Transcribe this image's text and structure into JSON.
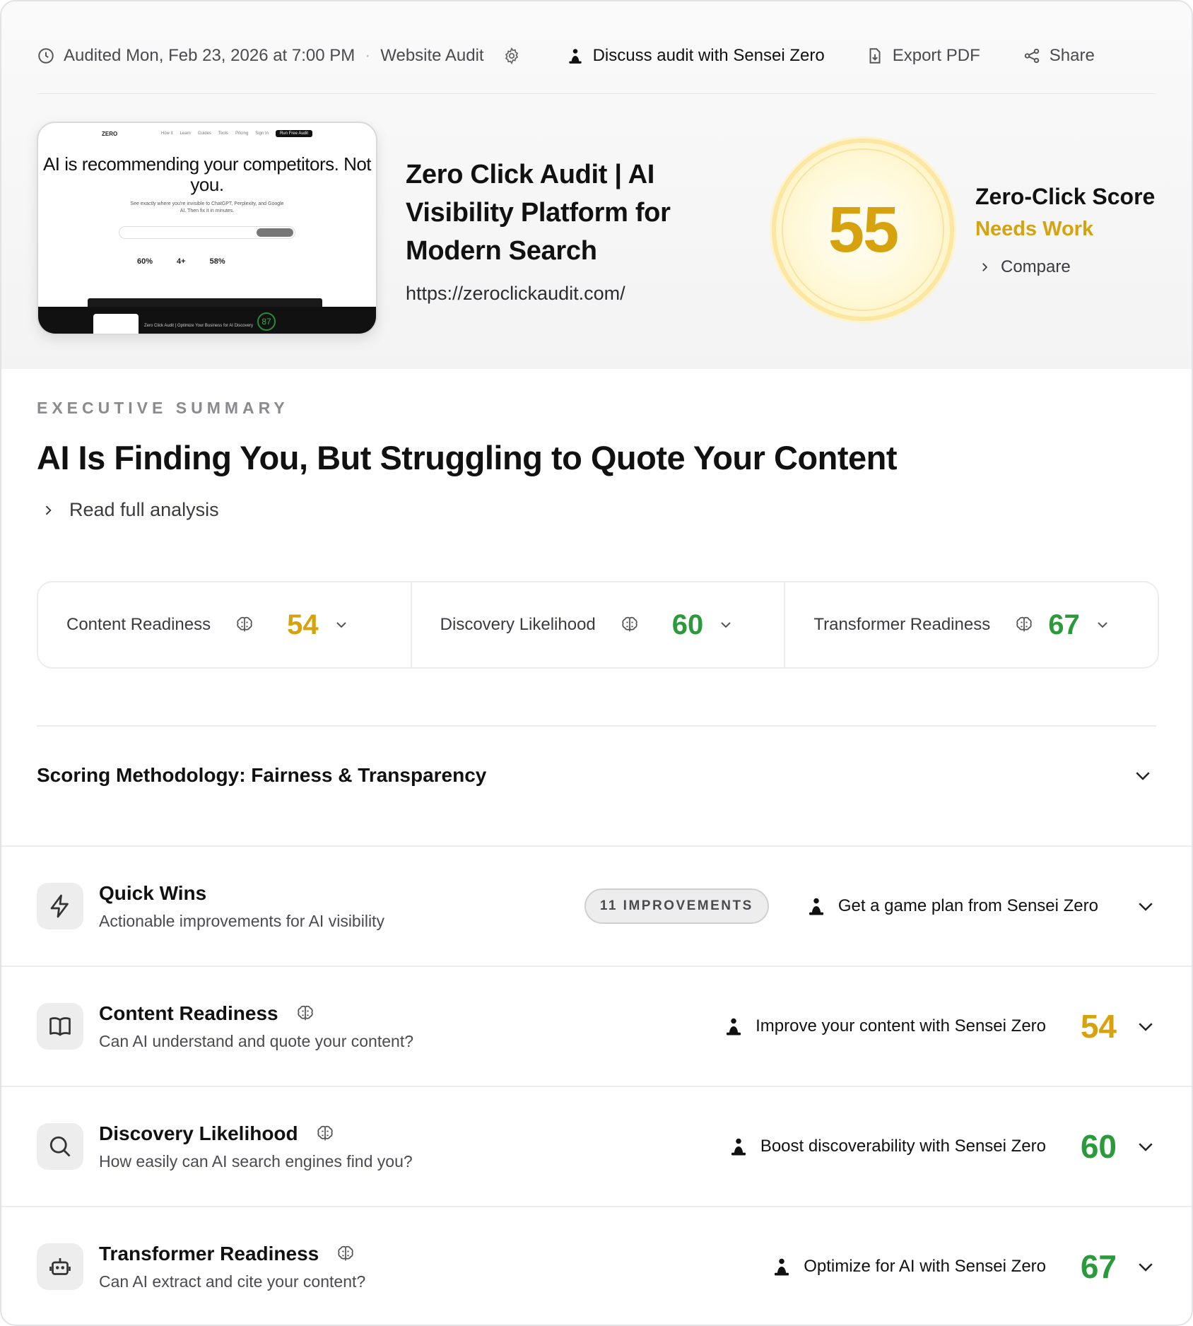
{
  "header": {
    "audited": "Audited Mon, Feb 23, 2026 at 7:00 PM",
    "separator": "·",
    "audit_type": "Website Audit",
    "discuss": "Discuss audit with Sensei Zero",
    "export": "Export PDF",
    "share": "Share"
  },
  "thumbnail": {
    "logo": "ZERO",
    "nav": [
      "How it",
      "Learn",
      "Guides",
      "Tools",
      "Pricing",
      "Sign In"
    ],
    "nav_button": "Run Free Audit",
    "headline": "AI is recommending your competitors. Not you.",
    "subtext": "See exactly where you're invisible to ChatGPT, Perplexity, and Google AI. Then fix it in minutes.",
    "stats": [
      "60%",
      "4+",
      "58%"
    ],
    "mini_score": "87",
    "dark_text": "Zero Click Audit | Optimize Your Business for AI Discovery"
  },
  "page": {
    "title": "Zero Click Audit | AI Visibility Platform for Modern Search",
    "url": "https://zeroclickaudit.com/"
  },
  "score": {
    "value": "55",
    "label": "Zero-Click Score",
    "status": "Needs Work",
    "compare": "Compare",
    "color": "#d6a30e"
  },
  "summary": {
    "eyebrow": "EXECUTIVE SUMMARY",
    "title": "AI Is Finding You, But Struggling to Quote Your Content",
    "read_full": "Read full analysis"
  },
  "metrics": [
    {
      "label": "Content Readiness",
      "value": "54",
      "color": "#d6a30e"
    },
    {
      "label": "Discovery Likelihood",
      "value": "60",
      "color": "#2a9a3a"
    },
    {
      "label": "Transformer Readiness",
      "value": "67",
      "color": "#2a9a3a"
    }
  ],
  "methodology": {
    "title": "Scoring Methodology: Fairness & Transparency"
  },
  "sections": {
    "quick_wins": {
      "title": "Quick Wins",
      "subtitle": "Actionable improvements for AI visibility",
      "badge": "11 IMPROVEMENTS",
      "action": "Get a game plan from Sensei Zero"
    },
    "content": {
      "title": "Content Readiness",
      "subtitle": "Can AI understand and quote your content?",
      "action": "Improve your content with Sensei Zero",
      "score": "54",
      "color": "#d6a30e"
    },
    "discovery": {
      "title": "Discovery Likelihood",
      "subtitle": "How easily can AI search engines find you?",
      "action": "Boost discoverability with Sensei Zero",
      "score": "60",
      "color": "#2a9a3a"
    },
    "transformer": {
      "title": "Transformer Readiness",
      "subtitle": "Can AI extract and cite your content?",
      "action": "Optimize for AI with Sensei Zero",
      "score": "67",
      "color": "#2a9a3a"
    }
  },
  "icons": [
    "clock-icon",
    "gear-icon",
    "monk-icon",
    "file-download-icon",
    "share-icon",
    "brain-icon",
    "chevron-down-icon",
    "chevron-right-icon",
    "lightning-icon",
    "book-icon",
    "search-icon",
    "robot-icon"
  ]
}
